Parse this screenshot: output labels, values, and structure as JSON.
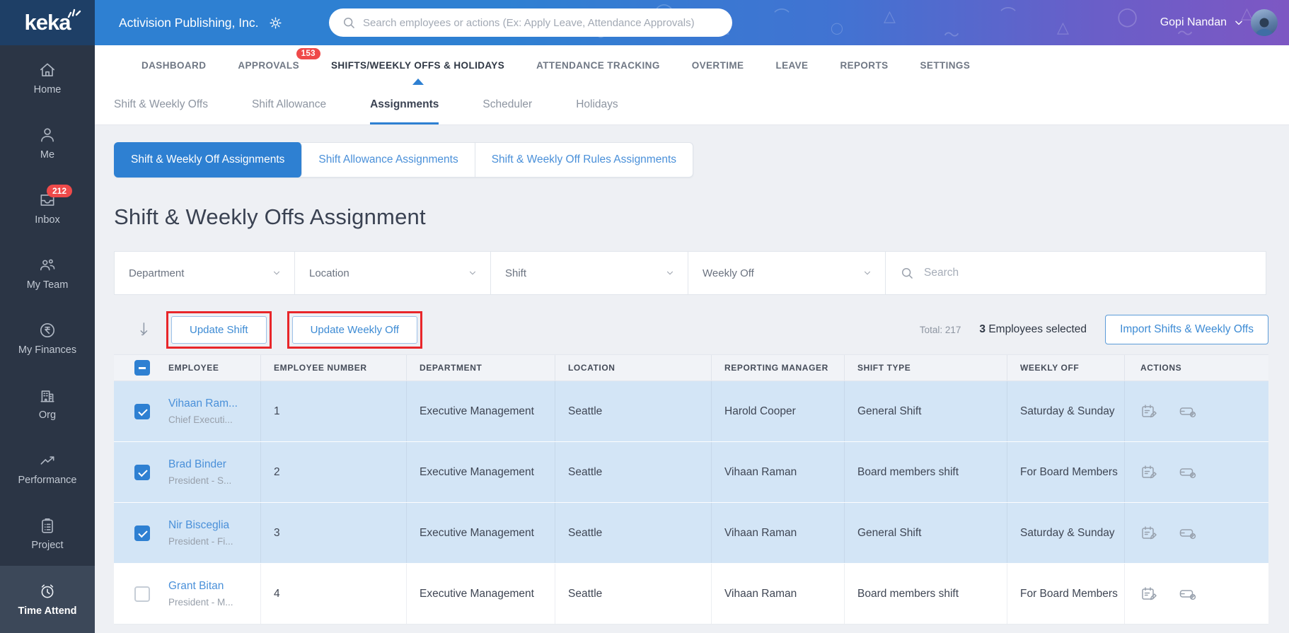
{
  "header": {
    "logo": "keka",
    "company": "Activision Publishing, Inc.",
    "search_placeholder": "Search employees or actions (Ex: Apply Leave, Attendance Approvals)",
    "user": "Gopi Nandan"
  },
  "sidebar": {
    "items": [
      {
        "label": "Home"
      },
      {
        "label": "Me"
      },
      {
        "label": "Inbox",
        "badge": "212"
      },
      {
        "label": "My Team"
      },
      {
        "label": "My Finances"
      },
      {
        "label": "Org"
      },
      {
        "label": "Performance"
      },
      {
        "label": "Project"
      },
      {
        "label": "Time Attend",
        "active": true
      }
    ]
  },
  "main_nav": {
    "items": [
      {
        "label": "DASHBOARD"
      },
      {
        "label": "APPROVALS",
        "badge": "153"
      },
      {
        "label": "SHIFTS/WEEKLY OFFS & HOLIDAYS",
        "active": true
      },
      {
        "label": "ATTENDANCE TRACKING"
      },
      {
        "label": "OVERTIME"
      },
      {
        "label": "LEAVE"
      },
      {
        "label": "REPORTS"
      },
      {
        "label": "SETTINGS"
      }
    ]
  },
  "sub_nav": {
    "items": [
      {
        "label": "Shift & Weekly Offs"
      },
      {
        "label": "Shift Allowance"
      },
      {
        "label": "Assignments",
        "active": true
      },
      {
        "label": "Scheduler"
      },
      {
        "label": "Holidays"
      }
    ]
  },
  "view_switcher": {
    "buttons": [
      {
        "label": "Shift & Weekly Off Assignments",
        "active": true
      },
      {
        "label": "Shift Allowance Assignments"
      },
      {
        "label": "Shift & Weekly Off Rules Assignments"
      }
    ]
  },
  "page": {
    "title": "Shift & Weekly Offs Assignment"
  },
  "filters": {
    "department": "Department",
    "location": "Location",
    "shift": "Shift",
    "weekly_off": "Weekly Off",
    "search_placeholder": "Search"
  },
  "toolbar": {
    "update_shift": "Update Shift",
    "update_weekly_off": "Update Weekly Off",
    "total_label": "Total: 217",
    "selected_count": "3",
    "selected_text": " Employees selected",
    "import_button": "Import Shifts & Weekly Offs"
  },
  "table": {
    "columns": [
      "EMPLOYEE",
      "EMPLOYEE NUMBER",
      "DEPARTMENT",
      "LOCATION",
      "REPORTING MANAGER",
      "SHIFT TYPE",
      "WEEKLY OFF",
      "ACTIONS"
    ],
    "rows": [
      {
        "name": "Vihaan Ram...",
        "title": "Chief Executi...",
        "number": "1",
        "department": "Executive Management",
        "location": "Seattle",
        "manager": "Harold Cooper",
        "shift_type": "General Shift",
        "weekly_off": "Saturday & Sunday",
        "selected": true
      },
      {
        "name": "Brad Binder",
        "title": "President - S...",
        "number": "2",
        "department": "Executive Management",
        "location": "Seattle",
        "manager": "Vihaan Raman",
        "shift_type": "Board members shift",
        "weekly_off": "For Board Members",
        "selected": true
      },
      {
        "name": "Nir Bisceglia",
        "title": "President - Fi...",
        "number": "3",
        "department": "Executive Management",
        "location": "Seattle",
        "manager": "Vihaan Raman",
        "shift_type": "General Shift",
        "weekly_off": "Saturday & Sunday",
        "selected": true
      },
      {
        "name": "Grant Bitan",
        "title": "President - M...",
        "number": "4",
        "department": "Executive Management",
        "location": "Seattle",
        "manager": "Vihaan Raman",
        "shift_type": "Board members shift",
        "weekly_off": "For Board Members",
        "selected": false
      }
    ]
  },
  "colors": {
    "accent_blue": "#2e80d2",
    "badge_red": "#ef4a4a",
    "annotation_red": "#e8262a",
    "selected_row": "#d3e5f6",
    "link_blue": "#4a90d9",
    "sidebar_bg": "#2b3545",
    "logo_bg": "#1e3f66"
  }
}
